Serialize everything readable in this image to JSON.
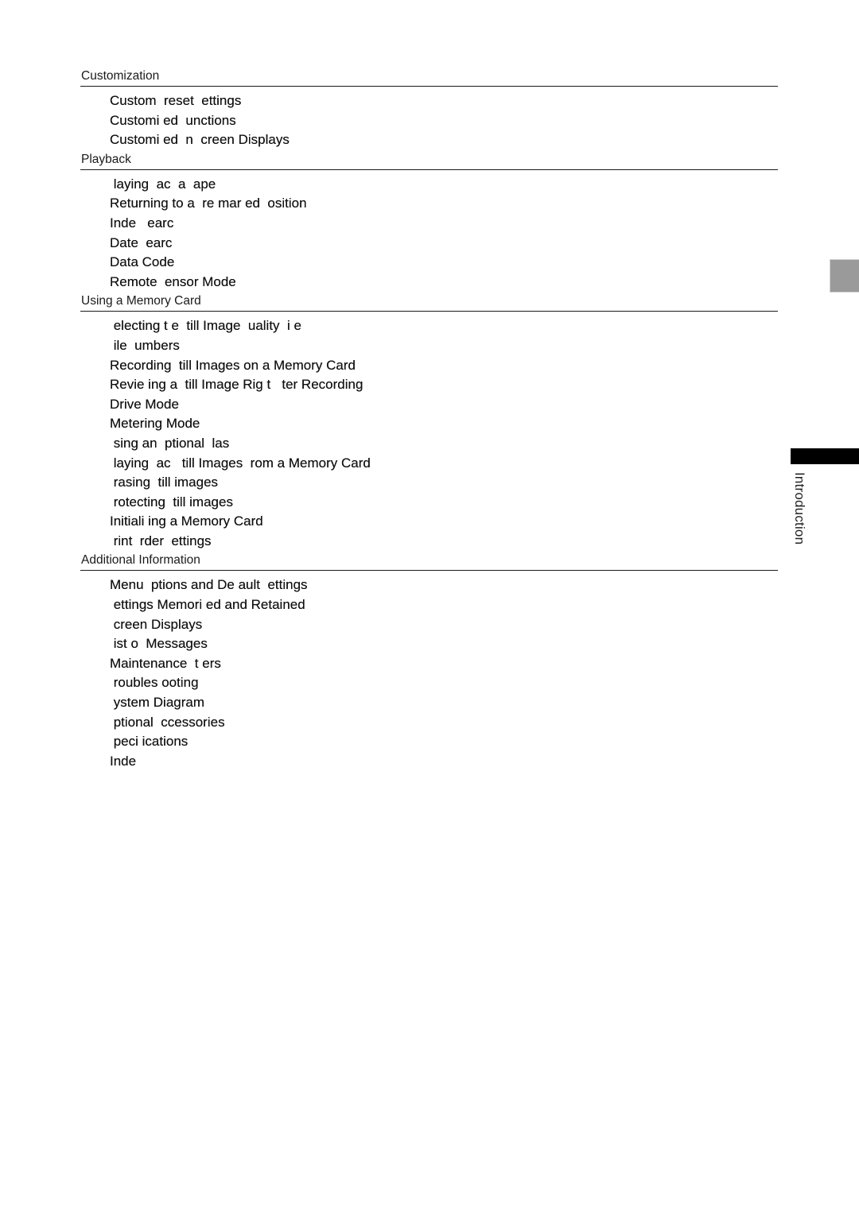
{
  "sections": [
    {
      "heading": "Customization",
      "items": [
        "Custom  reset  ettings",
        "Customi ed  unctions",
        "Customi ed  n  creen Displays"
      ]
    },
    {
      "heading": "Playback",
      "items": [
        " laying  ac  a  ape",
        "Returning to a  re mar ed  osition",
        "Inde   earc",
        "Date  earc",
        "Data Code",
        "Remote  ensor Mode"
      ]
    },
    {
      "heading": "Using a Memory Card",
      "items": [
        " electing t e  till Image  uality  i e",
        " ile  umbers",
        "Recording  till Images on a Memory Card",
        "Revie ing a  till Image Rig t   ter Recording",
        "Drive Mode",
        "Metering Mode",
        " sing an  ptional  las",
        " laying  ac   till Images  rom a Memory Card",
        " rasing  till images",
        " rotecting  till images",
        "Initiali ing a Memory Card",
        " rint  rder  ettings"
      ]
    },
    {
      "heading": "Additional Information",
      "items": [
        "Menu  ptions and De ault  ettings",
        " ettings Memori ed and Retained",
        " creen Displays",
        " ist o  Messages",
        "Maintenance  t ers",
        " roubles ooting",
        " ystem Diagram",
        " ptional  ccessories",
        " peci ications",
        "Inde"
      ]
    }
  ],
  "side_tab": {
    "label": "Introduction",
    "bar_color": "#000000",
    "gray_tab_color": "#9a9a9a"
  }
}
